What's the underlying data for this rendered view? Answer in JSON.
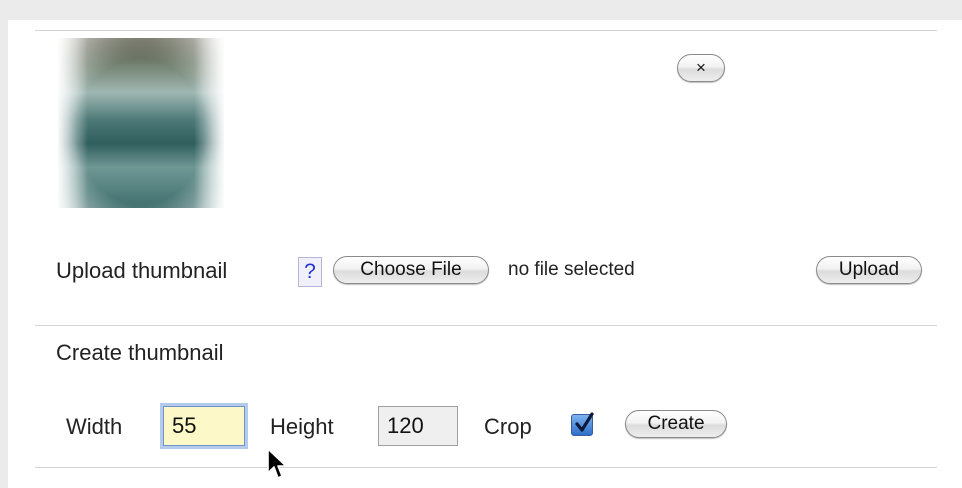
{
  "thumbnail": {
    "close_label": "×"
  },
  "upload": {
    "label": "Upload thumbnail",
    "help_label": "?",
    "choose_file_label": "Choose File",
    "file_status": "no file selected",
    "upload_label": "Upload"
  },
  "create": {
    "heading": "Create thumbnail",
    "width_label": "Width",
    "width_value": "55",
    "height_label": "Height",
    "height_value": "120",
    "crop_label": "Crop",
    "crop_checked": true,
    "create_label": "Create"
  },
  "colors": {
    "page_background": "#ebebeb",
    "panel_background": "#ffffff",
    "focused_input_fill": "#fdf8c8",
    "focus_ring": "#6f93c9",
    "help_link": "#2233cc",
    "checkbox_fill": "#2f6fc8"
  },
  "icons": {
    "close": "close-icon",
    "checkbox": "checkmark-icon",
    "cursor": "mouse-pointer-icon"
  }
}
